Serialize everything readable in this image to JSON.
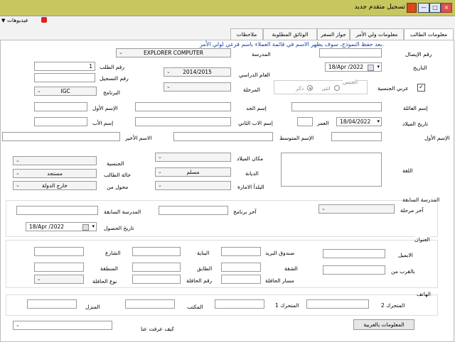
{
  "window": {
    "title": "تسجيل متقدم جديد"
  },
  "videos": {
    "label": "فيديوهات"
  },
  "tabs": [
    "معلومات الطالب",
    "معلومات ولي الأمر",
    "جواز السفر",
    "الوثائق المطلوبة",
    "ملاحظات"
  ],
  "notice": "بعد حفظ النموذج، سوف يظهر الاسم في قائمة العملاء باسم فرعي لولي الأمر.",
  "fields": {
    "receipt_no": {
      "label": "رقم الإيصال",
      "value": ""
    },
    "date": {
      "label": "التاريخ",
      "value": "18/Apr /2022"
    },
    "arab_nationality": {
      "label": "عربي الجنسية",
      "checked": true
    },
    "gender": {
      "label": "الجنس",
      "male": "ذكر",
      "female": "انثى",
      "selected": "male"
    },
    "school": {
      "label": "المدرسة",
      "value": "EXPLORER COMPUTER"
    },
    "academic_year": {
      "label": "العام الدراسي",
      "value": "2014/2015"
    },
    "stage": {
      "label": "المرحلة",
      "value": ""
    },
    "request_no": {
      "label": "رقم الطلب",
      "value": "1"
    },
    "registration_no": {
      "label": "رقم التسجيل",
      "value": ""
    },
    "program": {
      "label": "البرنامج",
      "value": "IGC"
    },
    "family_name": {
      "label": "إسم العائلة",
      "value": ""
    },
    "grandfather_name": {
      "label": "إسم الجد",
      "value": ""
    },
    "first_name_alt": {
      "label": "الإسم الأول",
      "value": ""
    },
    "birth_date": {
      "label": "تاريخ الميلاد",
      "value": "18/04/2022"
    },
    "age": {
      "label": "العمر",
      "value": ""
    },
    "second_father_name": {
      "label": "إسم الاب الثاني",
      "value": ""
    },
    "father_name": {
      "label": "إسم الأب",
      "value": ""
    },
    "first_name": {
      "label": "الإسم الأول",
      "value": ""
    },
    "middle_name": {
      "label": "الإسم المتوسط",
      "value": ""
    },
    "last_name": {
      "label": "الاسم الأخير",
      "value": ""
    },
    "language": {
      "label": "اللغة",
      "value": ""
    },
    "birth_place": {
      "label": "مكان الميلاد",
      "value": ""
    },
    "religion": {
      "label": "الديانة",
      "value": "مسلم"
    },
    "emirate": {
      "label": "البلدأ الامارة",
      "value": ""
    },
    "nationality": {
      "label": "الجنسية",
      "value": ""
    },
    "student_status": {
      "label": "حالة الطالب",
      "value": "مستجد"
    },
    "transferred_from": {
      "label": "محول من",
      "value": "خارج الدولة"
    }
  },
  "previous_school": {
    "title": "المدرسة السابقة",
    "last_stage": {
      "label": "آخر مرحلة",
      "value": ""
    },
    "last_program": {
      "label": "آخر برنامج",
      "value": ""
    },
    "school": {
      "label": "المدرسة السابقة",
      "value": ""
    },
    "obtain_date": {
      "label": "تاريخ الحصول",
      "value": "18/Apr /2022"
    }
  },
  "address": {
    "title": "العنوان",
    "email": {
      "label": "الايميل",
      "value": ""
    },
    "near": {
      "label": "بالقرب من",
      "value": ""
    },
    "po_box": {
      "label": "صندوق البريد",
      "value": ""
    },
    "apartment": {
      "label": "الشقة",
      "value": ""
    },
    "bus_route": {
      "label": "مسار الحافلة",
      "value": ""
    },
    "building": {
      "label": "البناية",
      "value": ""
    },
    "floor": {
      "label": "الطابق",
      "value": ""
    },
    "bus_no": {
      "label": "رقم الحافلة",
      "value": ""
    },
    "street": {
      "label": "الشارع",
      "value": ""
    },
    "area": {
      "label": "المنطقة",
      "value": ""
    },
    "bus_type": {
      "label": "نوع الحافلة",
      "value": ""
    }
  },
  "phone": {
    "title": "الهاتف",
    "mobile2": {
      "label": "المتحرك 2",
      "value": ""
    },
    "mobile1": {
      "label": "المتحرك 1",
      "value": ""
    },
    "office": {
      "label": "المكتب",
      "value": ""
    },
    "home": {
      "label": "المنزل",
      "value": ""
    }
  },
  "arabic_info_button": "المعلومات بالعربية",
  "how_know": {
    "label": "كيف عرفت عنا",
    "value": ""
  }
}
